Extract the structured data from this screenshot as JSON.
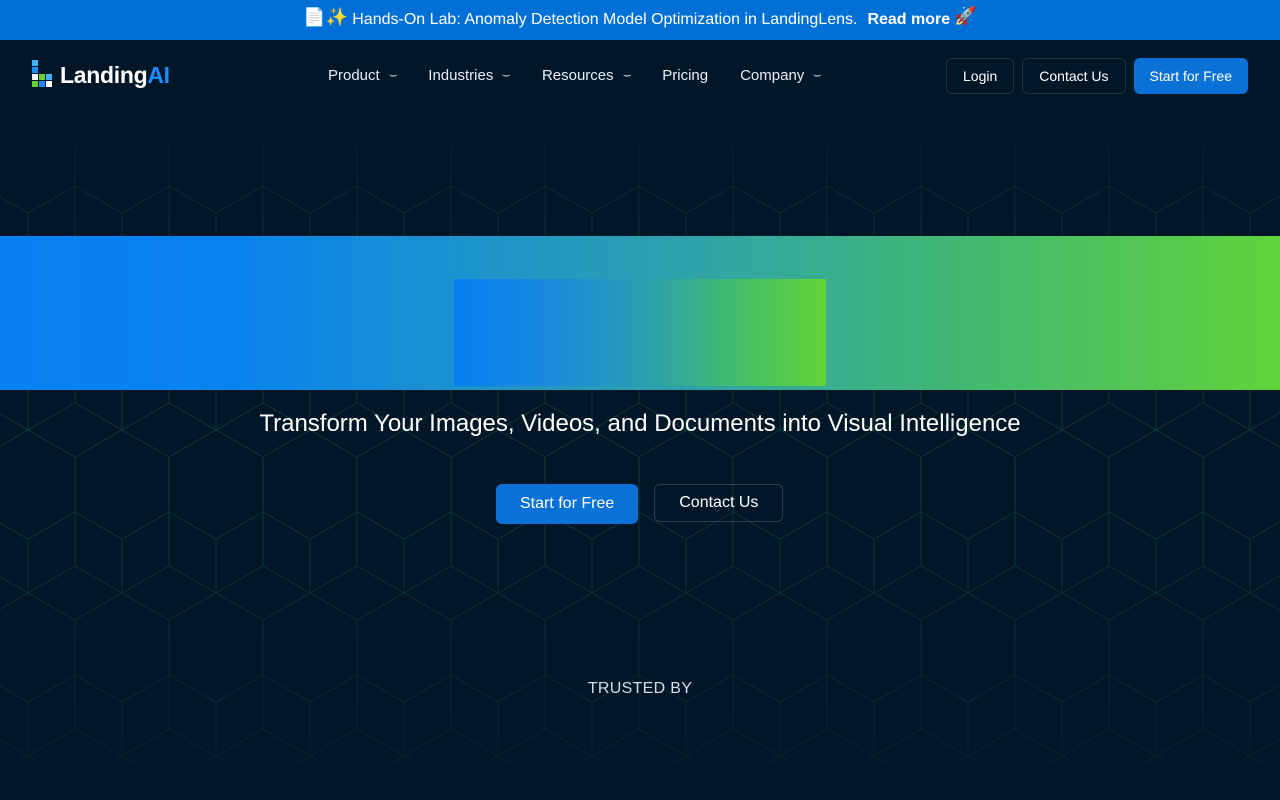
{
  "announcement": {
    "emoji": "📄✨",
    "text": "Hands-On Lab: Anomaly Detection Model Optimization in LandingLens.",
    "link_label": "Read more",
    "rocket": "🚀"
  },
  "logo": {
    "word": "Landing",
    "word_accent": "AI"
  },
  "nav": {
    "items": [
      {
        "label": "Product",
        "has_dropdown": true
      },
      {
        "label": "Industries",
        "has_dropdown": true
      },
      {
        "label": "Resources",
        "has_dropdown": true
      },
      {
        "label": "Pricing",
        "has_dropdown": false
      },
      {
        "label": "Company",
        "has_dropdown": true
      }
    ],
    "chevron": "⌣",
    "login_label": "Login",
    "contact_label": "Contact Us",
    "start_label": "Start for Free"
  },
  "hero": {
    "headline": "Transform Your Images, Videos, and Documents into Visual Intelligence",
    "start_label": "Start for Free",
    "contact_label": "Contact Us"
  },
  "trusted": {
    "label": "TRUSTED BY"
  },
  "colors": {
    "background": "#011627",
    "announcement_bg": "#0070d6",
    "primary_button": "#0a72d6",
    "gradient_start": "#0a7ff2",
    "gradient_end": "#61d33b"
  }
}
